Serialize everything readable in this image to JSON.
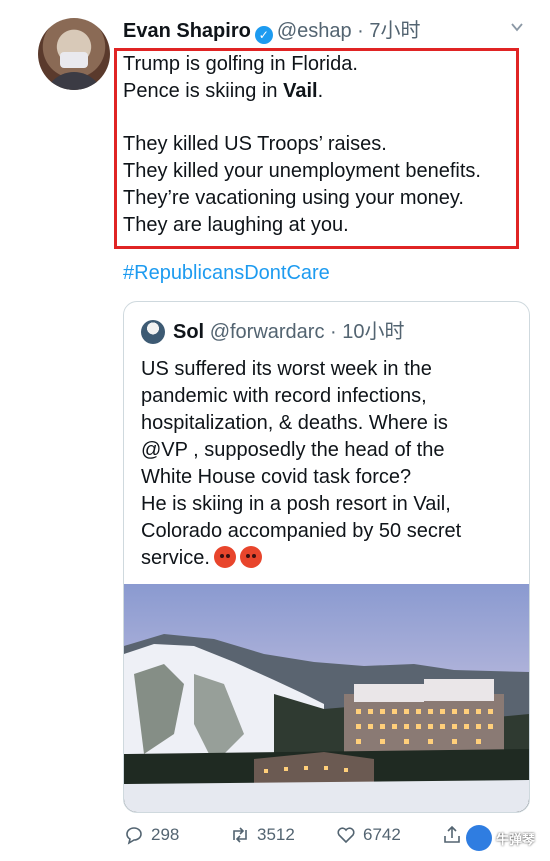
{
  "tweet": {
    "author_name": "Evan Shapiro",
    "handle_time": "@eshap · 7小时",
    "lines_before_bold": [
      "Trump is golfing in Florida."
    ],
    "pence_prefix": "Pence is skiing in ",
    "pence_bold": "Vail",
    "pence_suffix": ".",
    "lines_after": [
      "They killed US Troops’ raises.",
      "They killed your unemployment benefits.",
      "They’re vacationing using your money.",
      "They are laughing at you."
    ],
    "hashtag": "#RepublicansDontCare"
  },
  "quoted": {
    "author_name": "Sol",
    "handle_time": "@forwardarc · 10小时",
    "lines": [
      "US suffered its worst week in the",
      "pandemic with record infections,",
      "hospitalization, & deaths. Where is",
      "@VP , supposedly the head of the",
      "White House covid task force?",
      "He is skiing in a posh resort in Vail,",
      "Colorado accompanied by 50 secret"
    ],
    "last_line": "service."
  },
  "actions": {
    "replies": "298",
    "retweets": "3512",
    "likes": "6742"
  },
  "watermark": {
    "text": "牛弹琴"
  },
  "colors": {
    "accent": "#1d9bf0",
    "highlight_border": "#e02424",
    "meta": "#536471"
  }
}
